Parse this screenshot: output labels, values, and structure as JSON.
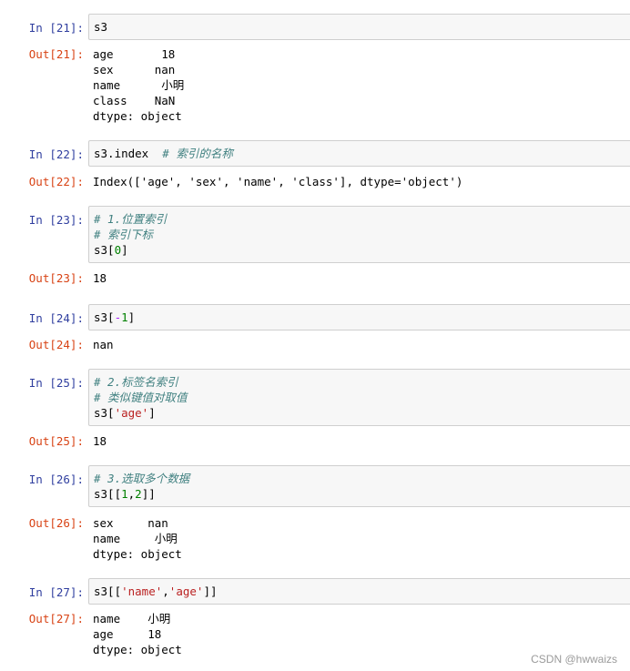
{
  "cells": [
    {
      "in_prompt": "In  [21]:",
      "out_prompt": "Out[21]:",
      "code": "s3",
      "output": "age       18\nsex      nan\nname      小明\nclass    NaN\ndtype: object"
    },
    {
      "in_prompt": "In  [22]:",
      "out_prompt": "Out[22]:",
      "code_main": "s3.index  ",
      "code_comment": "# 索引的名称",
      "output": "Index(['age', 'sex', 'name', 'class'], dtype='object')"
    },
    {
      "in_prompt": "In  [23]:",
      "out_prompt": "Out[23]:",
      "comment1": "# 1.位置索引",
      "comment2": "# 索引下标",
      "code_pre": "s3[",
      "code_num": "0",
      "code_post": "]",
      "output": "18"
    },
    {
      "in_prompt": "In  [24]:",
      "out_prompt": "Out[24]:",
      "code_pre": "s3[",
      "code_op": "-",
      "code_num": "1",
      "code_post": "]",
      "output": "nan"
    },
    {
      "in_prompt": "In  [25]:",
      "out_prompt": "Out[25]:",
      "comment1": "# 2.标签名索引",
      "comment2": "# 类似键值对取值",
      "code_pre": "s3[",
      "code_str": "'age'",
      "code_post": "]",
      "output": "18"
    },
    {
      "in_prompt": "In  [26]:",
      "out_prompt": "Out[26]:",
      "comment1": "# 3.选取多个数据",
      "code_pre": "s3[[",
      "code_num1": "1",
      "code_comma": ",",
      "code_num2": "2",
      "code_post": "]]",
      "output": "sex     nan\nname     小明\ndtype: object"
    },
    {
      "in_prompt": "In  [27]:",
      "out_prompt": "Out[27]:",
      "code_pre": "s3[[",
      "code_str1": "'name'",
      "code_comma": ",",
      "code_str2": "'age'",
      "code_post": "]]",
      "output": "name    小明\nage     18\ndtype: object"
    }
  ],
  "watermark": "CSDN @hwwaizs"
}
